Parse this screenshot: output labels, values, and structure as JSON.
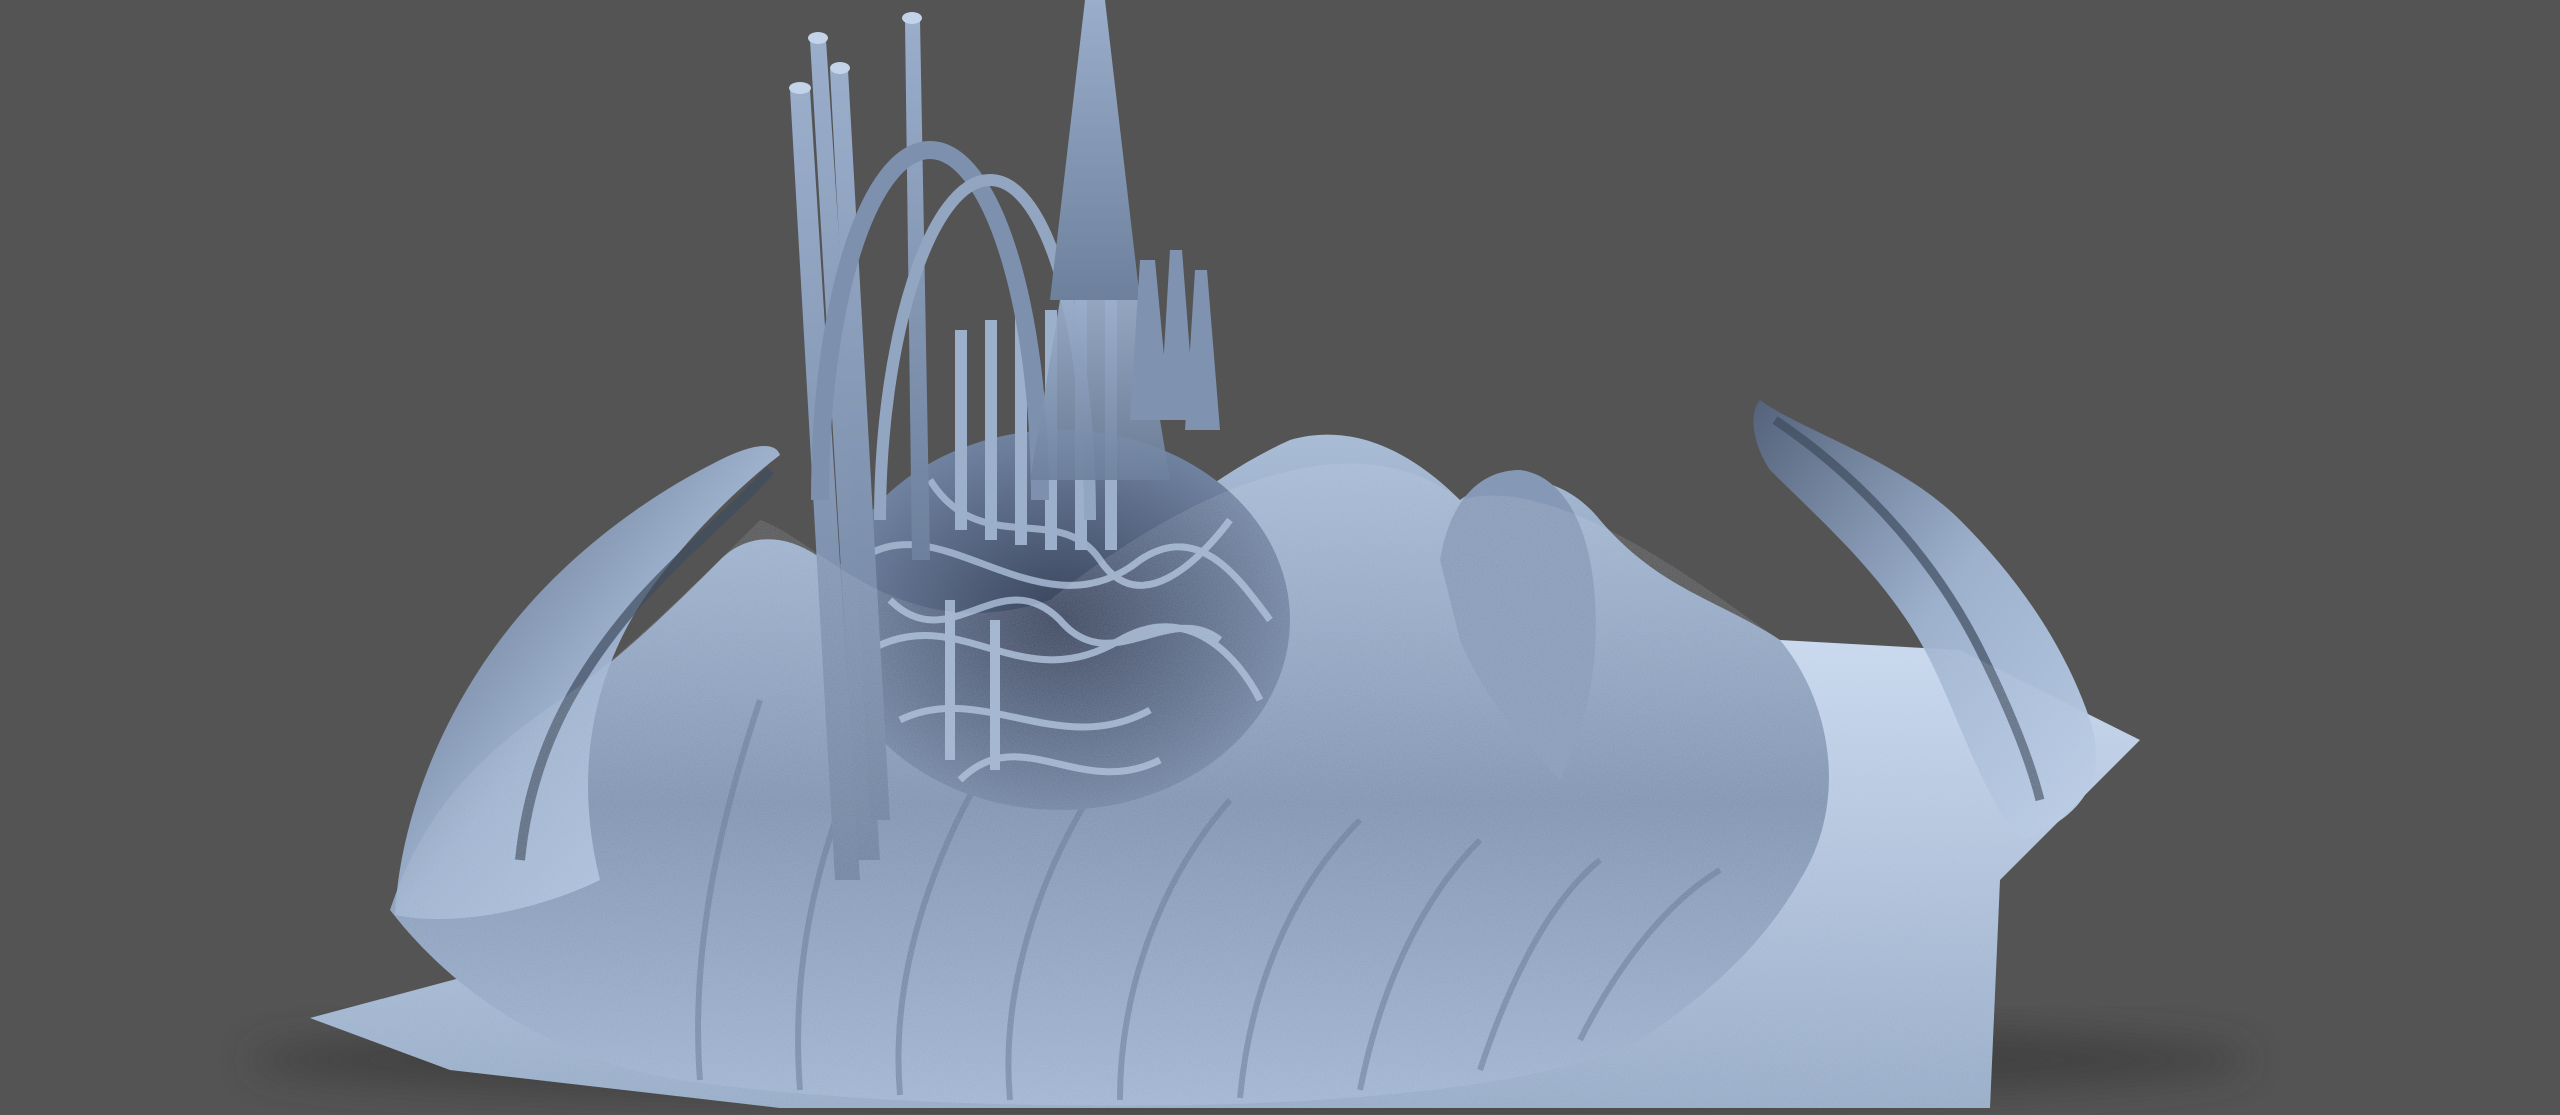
{
  "scene": {
    "subject": "abstract-sculpture-render",
    "colors": {
      "background": "#545454",
      "sculpture_light": "#b9cde6",
      "sculpture_mid": "#8ea3bf",
      "sculpture_dark": "#3f4b5e",
      "shadow": "#3a3a3a"
    }
  }
}
